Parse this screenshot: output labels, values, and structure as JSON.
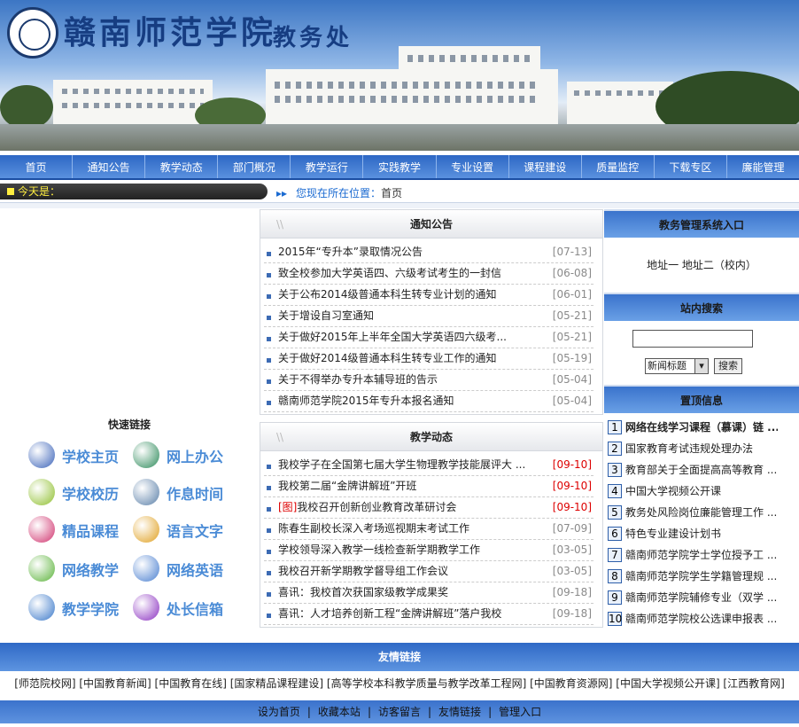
{
  "banner": {
    "school_name": "赣南师范学院",
    "dept_name": "教务处"
  },
  "nav": [
    "首页",
    "通知公告",
    "教学动态",
    "部门概况",
    "教学运行",
    "实践教学",
    "专业设置",
    "课程建设",
    "质量监控",
    "下载专区",
    "廉能管理"
  ],
  "datebar": {
    "today_label": "今天是：",
    "location_label": "您现在所在位置：",
    "location_value": "首页"
  },
  "quick_links": {
    "title": "快速链接",
    "items": [
      {
        "label": "学校主页",
        "icon": "ie-globe-icon",
        "color": "#3a62b8"
      },
      {
        "label": "网上办公",
        "icon": "computer-icon",
        "color": "#2d8a5a"
      },
      {
        "label": "学校校历",
        "icon": "calendar-icon",
        "color": "#8fbf2e"
      },
      {
        "label": "作息时间",
        "icon": "clock-icon",
        "color": "#5a7fa8"
      },
      {
        "label": "精品课程",
        "icon": "book-icon",
        "color": "#d0336e"
      },
      {
        "label": "语言文字",
        "icon": "gear-icon",
        "color": "#e0a020"
      },
      {
        "label": "网络教学",
        "icon": "crystal-icon",
        "color": "#5bb33a"
      },
      {
        "label": "网络英语",
        "icon": "notepad-icon",
        "color": "#4a7fd0"
      },
      {
        "label": "教学学院",
        "icon": "monitor-icon",
        "color": "#3a78c9"
      },
      {
        "label": "处长信箱",
        "icon": "star-icon",
        "color": "#8a30c0"
      }
    ]
  },
  "notices": {
    "title": "通知公告",
    "items": [
      {
        "title": "2015年“专升本”录取情况公告",
        "date": "[07-13]"
      },
      {
        "title": "致全校参加大学英语四、六级考试考生的一封信",
        "date": "[06-08]"
      },
      {
        "title": "关于公布2014级普通本科生转专业计划的通知",
        "date": "[06-01]"
      },
      {
        "title": "关于增设自习室通知",
        "date": "[05-21]"
      },
      {
        "title": "关于做好2015年上半年全国大学英语四六级考...",
        "date": "[05-21]"
      },
      {
        "title": "关于做好2014级普通本科生转专业工作的通知",
        "date": "[05-19]"
      },
      {
        "title": "关于不得举办专升本辅导班的告示",
        "date": "[05-04]"
      },
      {
        "title": "赣南师范学院2015年专升本报名通知",
        "date": "[05-04]"
      }
    ]
  },
  "news": {
    "title": "教学动态",
    "items": [
      {
        "title": "我校学子在全国第七届大学生物理教学技能展评大 ...",
        "date": "[09-10]",
        "red": true,
        "prefix": ""
      },
      {
        "title": "我校第二届“金牌讲解班”开班",
        "date": "[09-10]",
        "red": true,
        "prefix": ""
      },
      {
        "title": "我校召开创新创业教育改革研讨会",
        "date": "[09-10]",
        "red": true,
        "prefix": "[图]"
      },
      {
        "title": "陈春生副校长深入考场巡视期末考试工作",
        "date": "[07-09]",
        "red": false,
        "prefix": ""
      },
      {
        "title": "学校领导深入教学一线检查新学期教学工作",
        "date": "[03-05]",
        "red": false,
        "prefix": ""
      },
      {
        "title": "我校召开新学期教学督导组工作会议",
        "date": "[03-05]",
        "red": false,
        "prefix": ""
      },
      {
        "title": "喜讯：我校首次获国家级教学成果奖",
        "date": "[09-18]",
        "red": false,
        "prefix": ""
      },
      {
        "title": "喜讯：人才培养创新工程“金牌讲解班”落户我校",
        "date": "[09-18]",
        "red": false,
        "prefix": ""
      }
    ]
  },
  "system": {
    "title": "教务管理系统入口",
    "links": "地址一 地址二（校内）"
  },
  "search": {
    "title": "站内搜索",
    "select_value": "新闻标题",
    "button": "搜索"
  },
  "tops": {
    "title": "置顶信息",
    "items": [
      {
        "n": "1",
        "t": "网络在线学习课程（慕课）链 ..."
      },
      {
        "n": "2",
        "t": "国家教育考试违规处理办法"
      },
      {
        "n": "3",
        "t": "教育部关于全面提高高等教育 ..."
      },
      {
        "n": "4",
        "t": "中国大学视频公开课"
      },
      {
        "n": "5",
        "t": "教务处风险岗位廉能管理工作 ..."
      },
      {
        "n": "6",
        "t": "特色专业建设计划书"
      },
      {
        "n": "7",
        "t": "赣南师范学院学士学位授予工 ..."
      },
      {
        "n": "8",
        "t": "赣南师范学院学生学籍管理规 ..."
      },
      {
        "n": "9",
        "t": "赣南师范学院辅修专业（双学 ..."
      },
      {
        "n": "10",
        "t": "赣南师范学院校公选课申报表 ..."
      }
    ]
  },
  "friends": {
    "title": "友情链接",
    "links": "[师范院校网] [中国教育新闻] [中国教育在线] [国家精品课程建设] [高等学校本科教学质量与教学改革工程网] [中国教育资源网] [中国大学视频公开课] [江西教育网]"
  },
  "footer": [
    "设为首页",
    "收藏本站",
    "访客留言",
    "友情链接",
    "管理入口"
  ]
}
